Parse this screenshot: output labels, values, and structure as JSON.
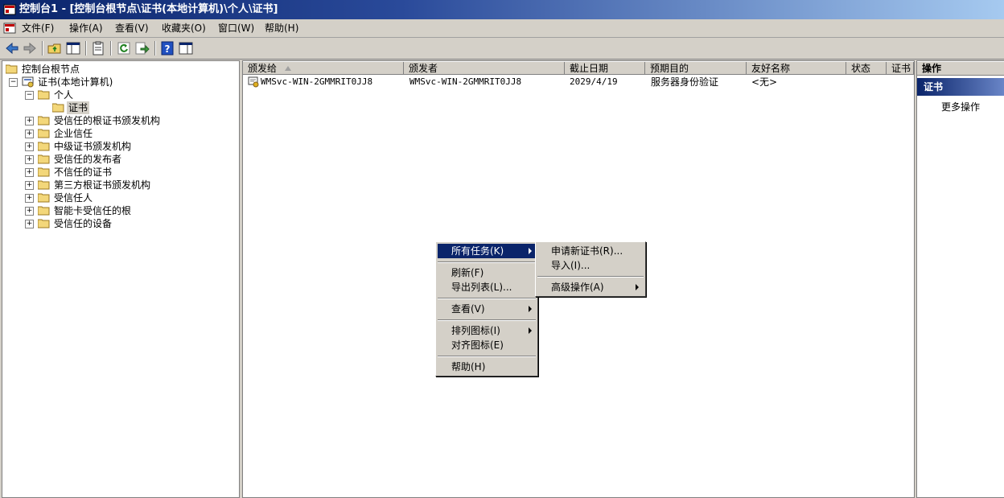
{
  "window": {
    "title": "控制台1 - [控制台根节点\\证书(本地计算机)\\个人\\证书]"
  },
  "menubar": [
    "文件(F)",
    "操作(A)",
    "查看(V)",
    "收藏夹(O)",
    "窗口(W)",
    "帮助(H)"
  ],
  "tree": {
    "root": "控制台根节点",
    "store": "证书(本地计算机)",
    "personal": "个人",
    "certs": "证书",
    "folders": [
      "受信任的根证书颁发机构",
      "企业信任",
      "中级证书颁发机构",
      "受信任的发布者",
      "不信任的证书",
      "第三方根证书颁发机构",
      "受信任人",
      "智能卡受信任的根",
      "受信任的设备"
    ]
  },
  "list": {
    "columns": [
      "颁发给",
      "颁发者",
      "截止日期",
      "预期目的",
      "友好名称",
      "状态",
      "证书"
    ],
    "rows": [
      {
        "issued_to": "WMSvc-WIN-2GMMRIT0JJ8",
        "issued_by": "WMSvc-WIN-2GMMRIT0JJ8",
        "expiration": "2029/4/19",
        "purposes": "服务器身份验证",
        "friendly_name": "<无>"
      }
    ]
  },
  "actions": {
    "header": "操作",
    "section": "证书",
    "more": "更多操作"
  },
  "context_menu": {
    "all_tasks": "所有任务(K)",
    "refresh": "刷新(F)",
    "export_list": "导出列表(L)...",
    "view": "查看(V)",
    "arrange_icons": "排列图标(I)",
    "align_icons": "对齐图标(E)",
    "help": "帮助(H)"
  },
  "submenu": {
    "request_new": "申请新证书(R)...",
    "import": "导入(I)...",
    "advanced": "高级操作(A)"
  },
  "colors": {
    "highlight": "#0a246a",
    "face": "#d4d0c8"
  }
}
